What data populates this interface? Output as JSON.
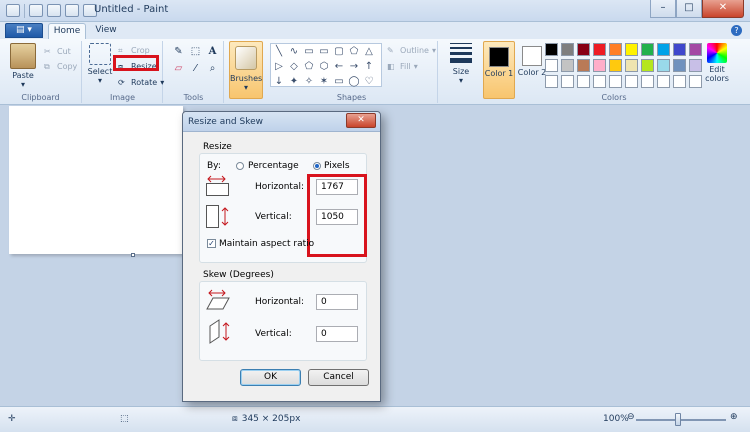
{
  "window": {
    "title": "Untitled - Paint",
    "controls": {
      "minimize": "–",
      "maximize": "□",
      "close": "✕"
    }
  },
  "ribbon_tabs": {
    "app_menu": "▤ ▾",
    "home": "Home",
    "view": "View",
    "help": "?"
  },
  "ribbon": {
    "clipboard": {
      "paste": "Paste",
      "cut": "Cut",
      "copy": "Copy",
      "label": "Clipboard"
    },
    "image": {
      "select": "Select",
      "crop": "Crop",
      "resize": "Resize",
      "rotate": "Rotate",
      "label": "Image"
    },
    "tools": {
      "label": "Tools",
      "items": [
        "✎",
        "⬚",
        "A",
        "▱",
        "⁄",
        "⌕"
      ]
    },
    "brushes": "Brushes",
    "shapes": {
      "label": "Shapes",
      "items": [
        "╲",
        "∿",
        "▭",
        "▭",
        "▢",
        "⬠",
        "△",
        "▷",
        "◇",
        "⬠",
        "⬡",
        "←",
        "→",
        "↑",
        "↓",
        "✦",
        "✧",
        "✶",
        "▭",
        "◯",
        "♡"
      ],
      "outline": "Outline",
      "fill": "Fill"
    },
    "size": "Size",
    "color1": "Color 1",
    "color2": "Color 2",
    "colors_label": "Colors",
    "edit_colors": "Edit colors",
    "palette": [
      "#000000",
      "#7f7f7f",
      "#880015",
      "#ed1c24",
      "#ff7f27",
      "#fff200",
      "#22b14c",
      "#00a2e8",
      "#3f48cc",
      "#a349a4",
      "#ffffff",
      "#c3c3c3",
      "#b97a57",
      "#ffaec9",
      "#ffc90e",
      "#efe4b0",
      "#b5e61d",
      "#99d9ea",
      "#7092be",
      "#c8bfe7",
      "#ffffff",
      "#ffffff",
      "#ffffff",
      "#ffffff",
      "#ffffff",
      "#ffffff",
      "#ffffff",
      "#ffffff",
      "#ffffff",
      "#ffffff"
    ],
    "color1_value": "#000000",
    "color2_value": "#ffffff"
  },
  "dialog": {
    "title": "Resize and Skew",
    "close": "✕",
    "resize_section": "Resize",
    "by_label": "By:",
    "percentage": "Percentage",
    "pixels": "Pixels",
    "horizontal_label": "Horizontal:",
    "horizontal_value": "1767",
    "vertical_label": "Vertical:",
    "vertical_value": "1050",
    "maintain_aspect": "Maintain aspect ratio",
    "skew_section": "Skew (Degrees)",
    "skew_horizontal_label": "Horizontal:",
    "skew_horizontal_value": "0",
    "skew_vertical_label": "Vertical:",
    "skew_vertical_value": "0",
    "ok": "OK",
    "cancel": "Cancel"
  },
  "status": {
    "selection_size": "345 × 205px",
    "zoom": "100%",
    "zoom_minus": "⊖",
    "zoom_plus": "⊕"
  }
}
